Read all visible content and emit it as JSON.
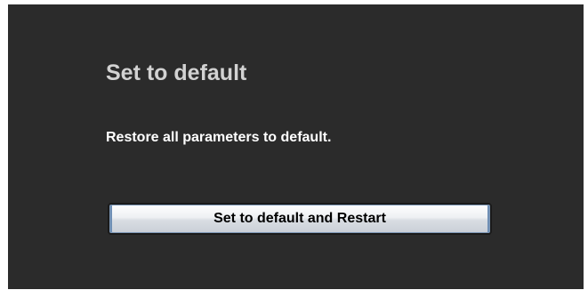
{
  "section": {
    "title": "Set to default",
    "description": "Restore all parameters to default.",
    "restart_button_label": "Set to default and Restart"
  }
}
